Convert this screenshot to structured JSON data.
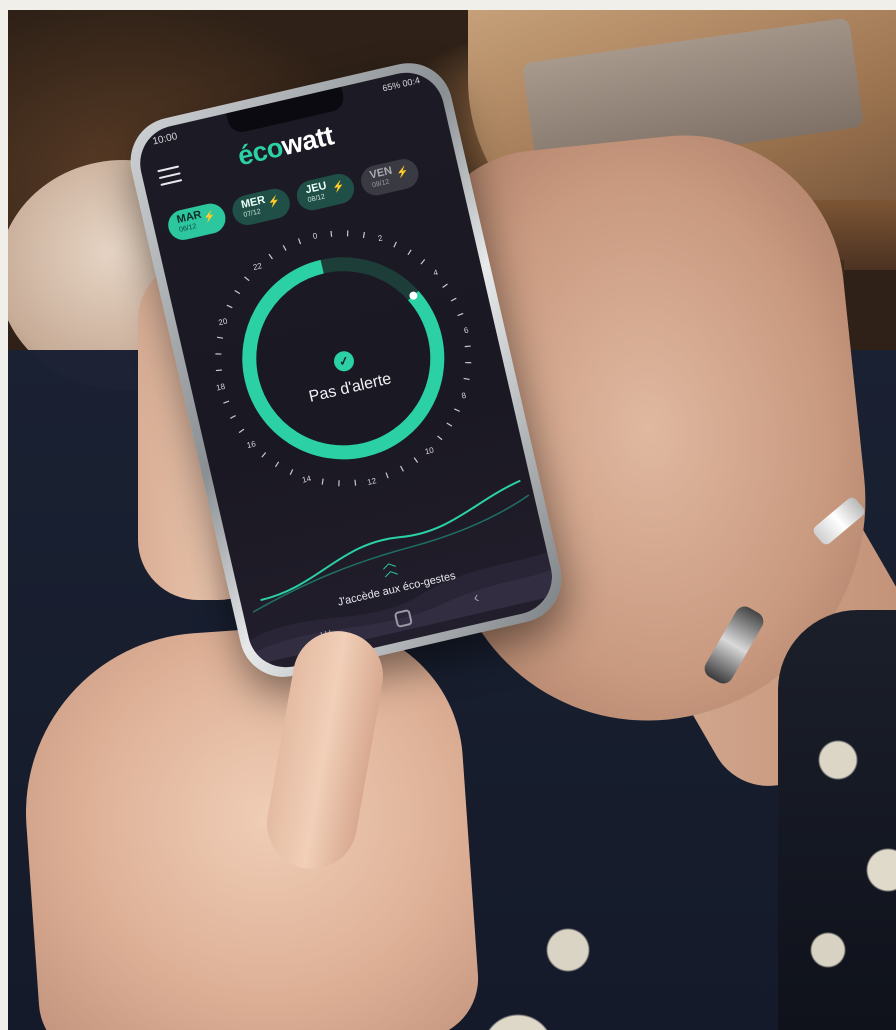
{
  "app": {
    "logo_eco": "éco",
    "logo_watt": "watt"
  },
  "status_bar": {
    "time": "10:00",
    "right": "65% 00:4"
  },
  "days": [
    {
      "label": "MAR",
      "date": "06/12",
      "state": "active"
    },
    {
      "label": "MER",
      "date": "07/12",
      "state": "normal"
    },
    {
      "label": "JEU",
      "date": "08/12",
      "state": "normal"
    },
    {
      "label": "VEN",
      "date": "09/12",
      "state": "future"
    }
  ],
  "dial": {
    "status_text": "Pas d'alerte",
    "hour_labels": [
      "0",
      "2",
      "4",
      "6",
      "8",
      "10",
      "12",
      "14",
      "16",
      "18",
      "20",
      "22"
    ],
    "ring_fill": 0.83,
    "colors": {
      "accent": "#2bd0a4",
      "track": "#1d3d38"
    }
  },
  "cta": {
    "text": "J'accède aux éco-gestes"
  },
  "navbar": {
    "recents_glyph": "III",
    "home_glyph": "",
    "back_glyph": "‹"
  }
}
